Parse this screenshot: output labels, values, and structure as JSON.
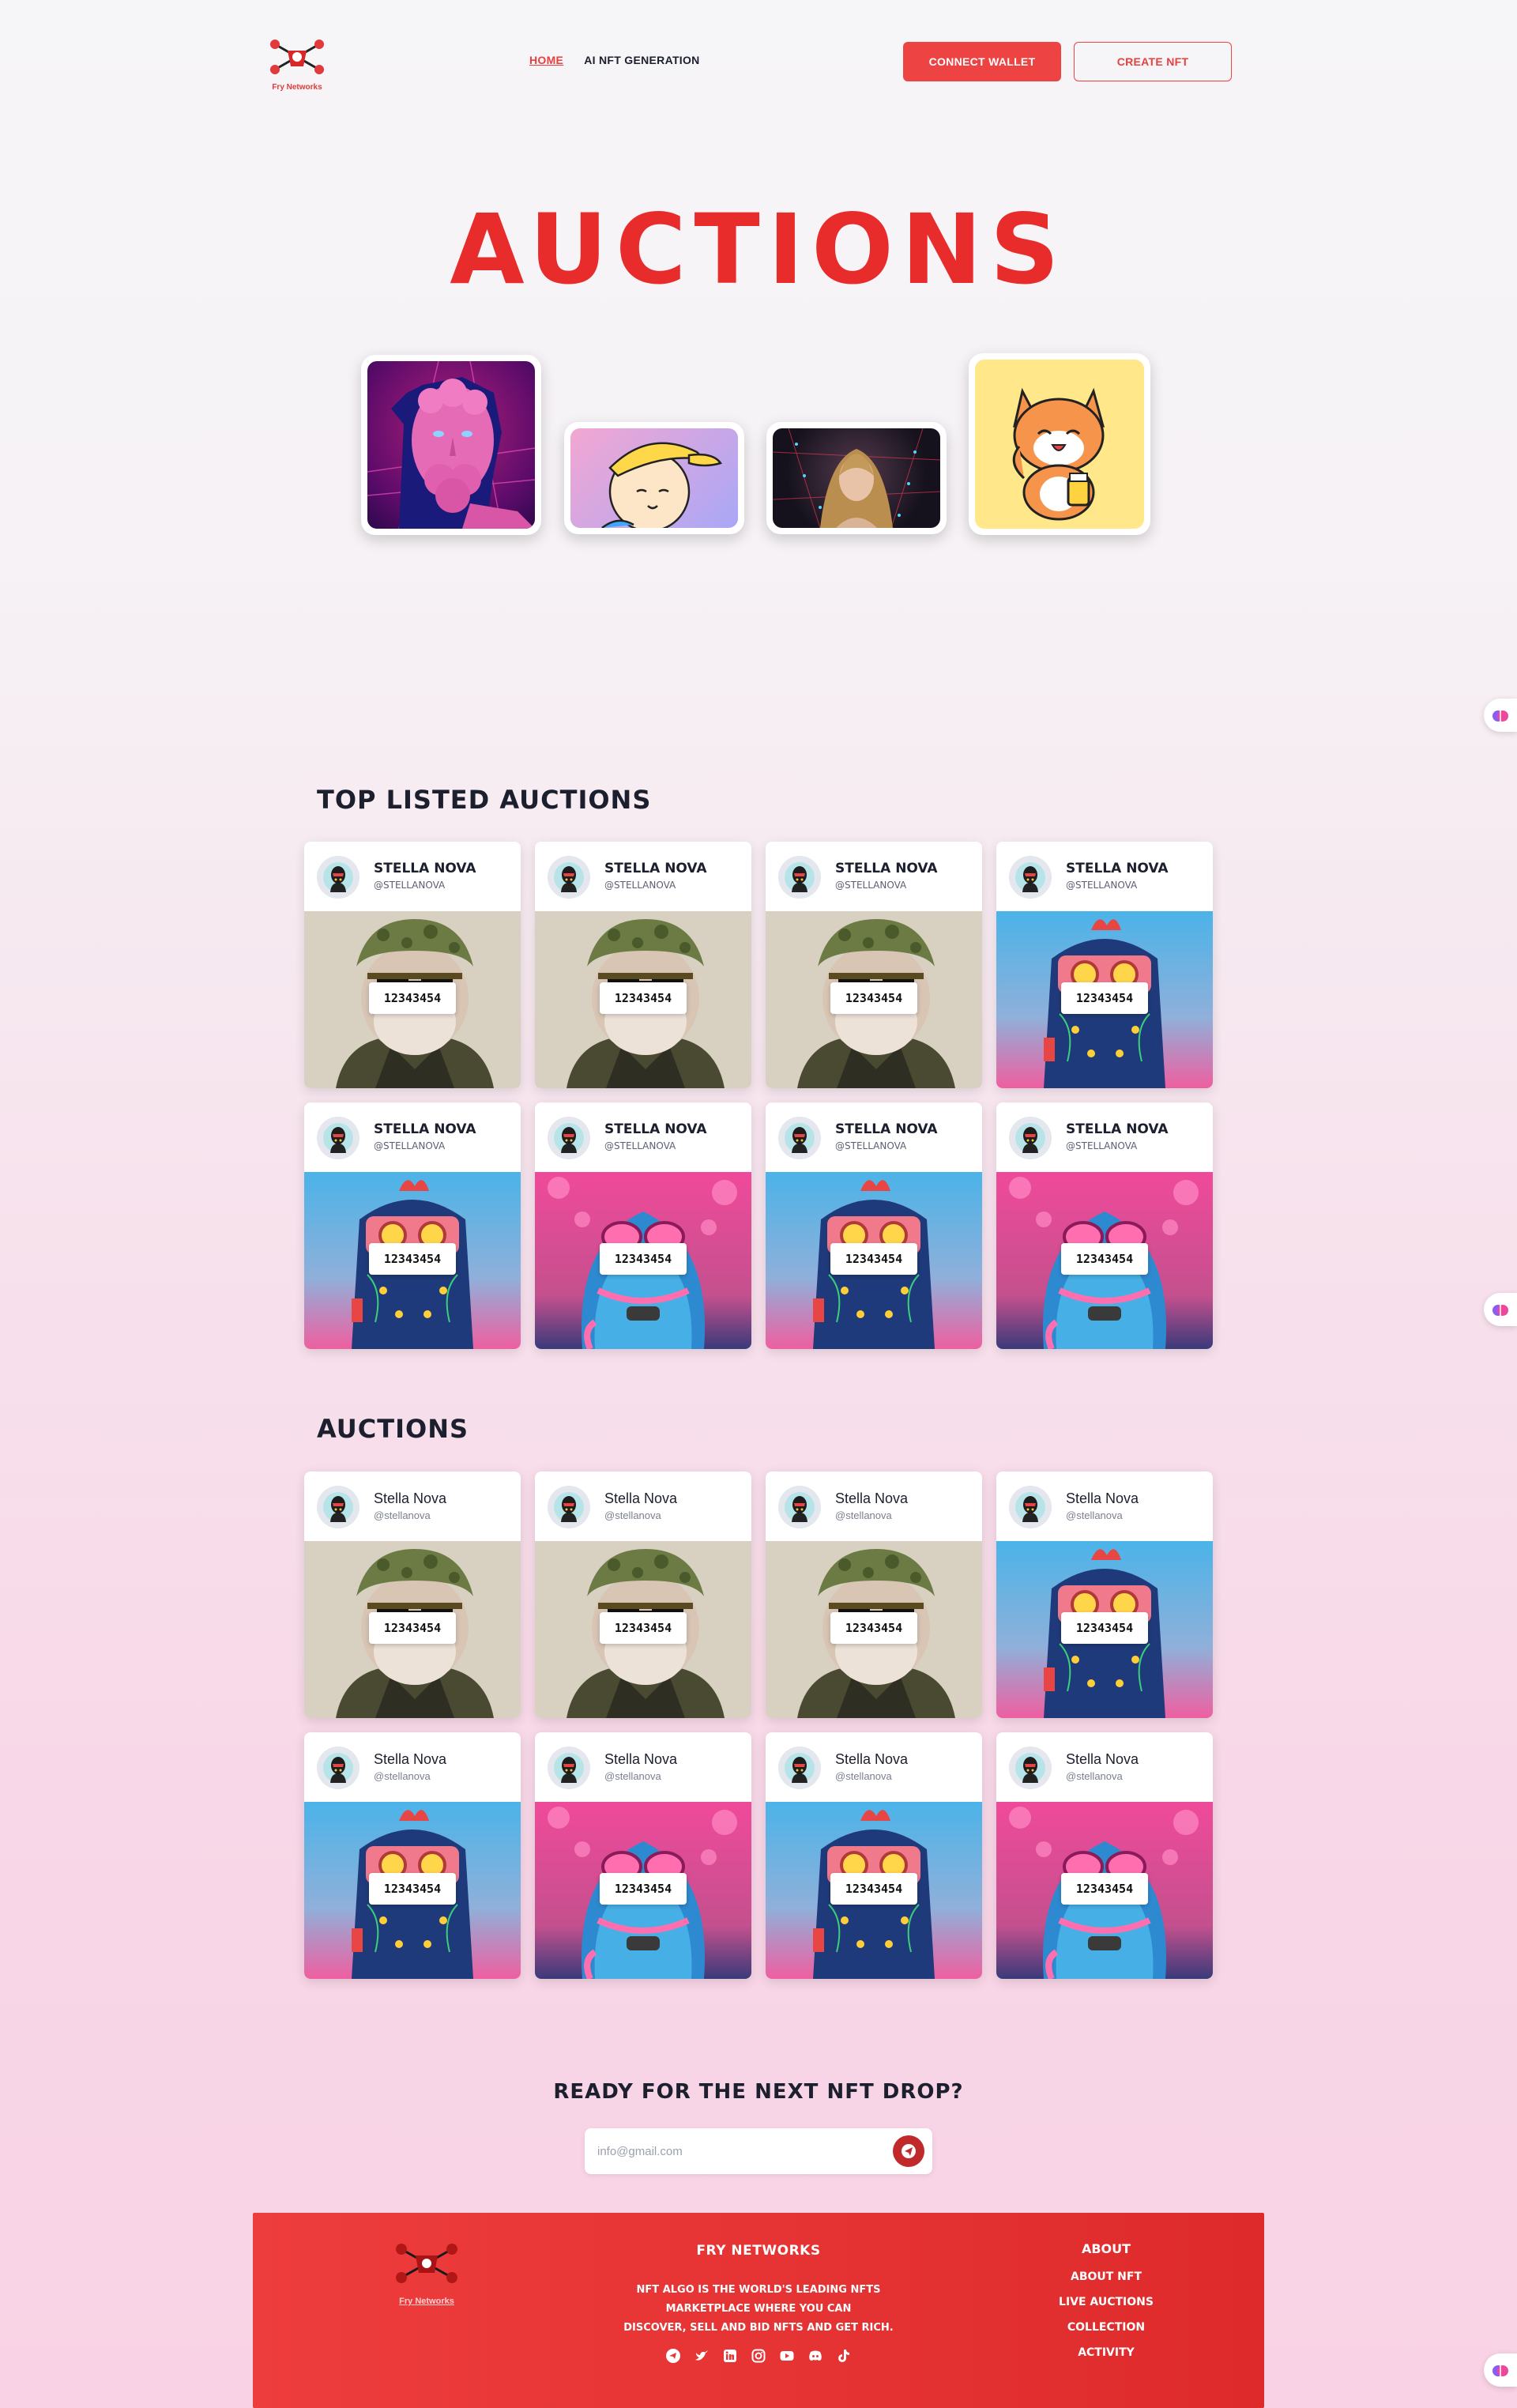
{
  "header": {
    "logo_text": "Fry Networks",
    "nav": [
      {
        "label": "HOME",
        "active": true
      },
      {
        "label": "AI NFT GENERATION",
        "active": false
      }
    ],
    "connect_wallet": "CONNECT WALLET",
    "create_nft": "CREATE NFT"
  },
  "hero": {
    "title": "AUCTIONS",
    "images": [
      "pink-statue-art",
      "cartoon-boy-cap-art",
      "neon-woman-art",
      "lucky-cat-art"
    ]
  },
  "top_listed": {
    "title": "TOP LISTED AUCTIONS",
    "cards": [
      {
        "name": "STELLA NOVA",
        "handle": "@STELLANOVA",
        "price": "12343454",
        "art": "ape"
      },
      {
        "name": "STELLA NOVA",
        "handle": "@STELLANOVA",
        "price": "12343454",
        "art": "ape"
      },
      {
        "name": "STELLA NOVA",
        "handle": "@STELLANOVA",
        "price": "12343454",
        "art": "ape"
      },
      {
        "name": "STELLA NOVA",
        "handle": "@STELLANOVA",
        "price": "12343454",
        "art": "robot"
      },
      {
        "name": "STELLA NOVA",
        "handle": "@STELLANOVA",
        "price": "12343454",
        "art": "robot"
      },
      {
        "name": "STELLA NOVA",
        "handle": "@STELLANOVA",
        "price": "12343454",
        "art": "bird"
      },
      {
        "name": "STELLA NOVA",
        "handle": "@STELLANOVA",
        "price": "12343454",
        "art": "robot"
      },
      {
        "name": "STELLA NOVA",
        "handle": "@STELLANOVA",
        "price": "12343454",
        "art": "bird"
      }
    ]
  },
  "auctions": {
    "title": "AUCTIONS",
    "cards": [
      {
        "name": "Stella Nova",
        "handle": "@stellanova",
        "price": "12343454",
        "art": "ape"
      },
      {
        "name": "Stella Nova",
        "handle": "@stellanova",
        "price": "12343454",
        "art": "ape"
      },
      {
        "name": "Stella Nova",
        "handle": "@stellanova",
        "price": "12343454",
        "art": "ape"
      },
      {
        "name": "Stella Nova",
        "handle": "@stellanova",
        "price": "12343454",
        "art": "robot"
      },
      {
        "name": "Stella Nova",
        "handle": "@stellanova",
        "price": "12343454",
        "art": "robot"
      },
      {
        "name": "Stella Nova",
        "handle": "@stellanova",
        "price": "12343454",
        "art": "bird"
      },
      {
        "name": "Stella Nova",
        "handle": "@stellanova",
        "price": "12343454",
        "art": "robot"
      },
      {
        "name": "Stella Nova",
        "handle": "@stellanova",
        "price": "12343454",
        "art": "bird"
      }
    ]
  },
  "newsletter": {
    "title": "READY FOR THE NEXT NFT DROP?",
    "placeholder": "info@gmail.com",
    "send_icon": "telegram-send-icon"
  },
  "footer": {
    "logo_text": "Fry Networks",
    "brand": "FRY NETWORKS",
    "desc_lines": [
      "NFT ALGO IS THE WORLD'S LEADING NFTS",
      "MARKETPLACE WHERE YOU CAN",
      "DISCOVER, SELL AND BID NFTS AND GET RICH."
    ],
    "social_icons": [
      "telegram-icon",
      "twitter-icon",
      "linkedin-icon",
      "instagram-icon",
      "youtube-icon",
      "discord-icon",
      "tiktok-icon"
    ],
    "about": {
      "title": "ABOUT",
      "links": [
        "ABOUT NFT",
        "LIVE AUCTIONS",
        "COLLECTION",
        "ACTIVITY"
      ]
    }
  },
  "colors": {
    "accent": "#ee4343",
    "title_red": "#e82b2b",
    "text_dark": "#1c1f2e"
  }
}
